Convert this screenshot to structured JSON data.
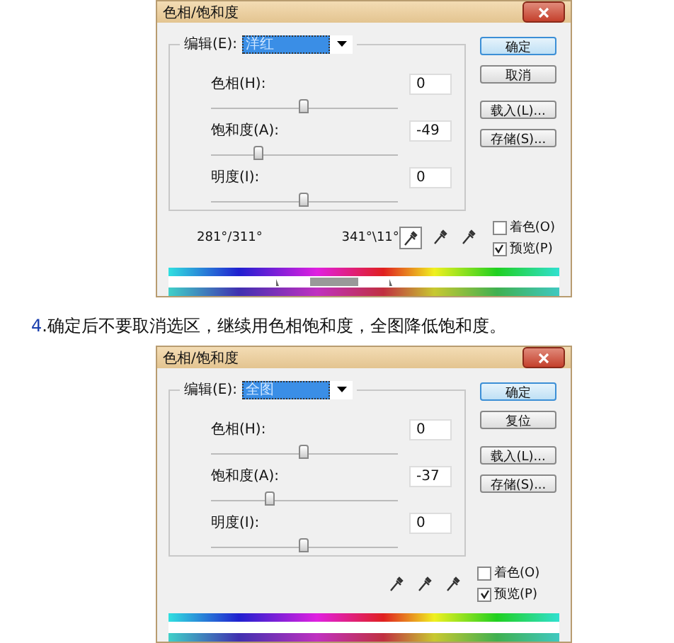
{
  "dialogs": [
    {
      "title": "色相/饱和度",
      "edit_label": "编辑(E):",
      "edit_value": "洋红",
      "sliders": [
        {
          "label": "色相(H):",
          "value": "0",
          "level": 0.5
        },
        {
          "label": "饱和度(A):",
          "value": "-49",
          "level": 0.26
        },
        {
          "label": "明度(I):",
          "value": "0",
          "level": 0.5
        }
      ],
      "buttons": [
        {
          "label": "确定",
          "selected": true
        },
        {
          "label": "取消",
          "selected": false
        },
        {
          "label": "载入(L)...",
          "selected": false
        },
        {
          "label": "存储(S)...",
          "selected": false
        }
      ],
      "readings": [
        "281°/311°",
        "341°\\11°"
      ],
      "eyedroppers": [
        {
          "selected": true
        },
        {
          "selected": false
        },
        {
          "selected": false
        }
      ],
      "checkboxes": [
        {
          "label": "着色(O)",
          "checked": false
        },
        {
          "label": "预览(P)",
          "checked": true
        }
      ],
      "range_adjuster": true
    },
    {
      "title": "色相/饱和度",
      "edit_label": "编辑(E):",
      "edit_value": "全图",
      "sliders": [
        {
          "label": "色相(H):",
          "value": "0",
          "level": 0.5
        },
        {
          "label": "饱和度(A):",
          "value": "-37",
          "level": 0.32
        },
        {
          "label": "明度(I):",
          "value": "0",
          "level": 0.5
        }
      ],
      "buttons": [
        {
          "label": "确定",
          "selected": true
        },
        {
          "label": "复位",
          "selected": false
        },
        {
          "label": "载入(L)...",
          "selected": false
        },
        {
          "label": "存储(S)...",
          "selected": false
        }
      ],
      "eyedroppers": [
        {
          "selected": false
        },
        {
          "selected": false
        },
        {
          "selected": false
        }
      ],
      "checkboxes": [
        {
          "label": "着色(O)",
          "checked": false
        },
        {
          "label": "预览(P)",
          "checked": true
        }
      ],
      "range_adjuster": false
    }
  ],
  "caption": {
    "number": "4",
    "text": ".确定后不要取消选区，继续用色相饱和度，全图降低饱和度。"
  }
}
